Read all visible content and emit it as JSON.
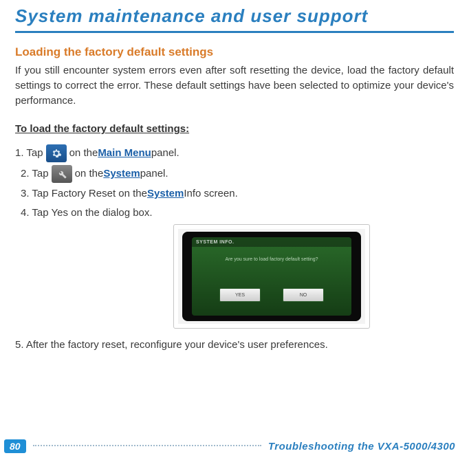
{
  "header": {
    "title": "System maintenance and user support"
  },
  "section": {
    "title": "Loading the factory default settings",
    "intro": "If you still encounter system errors even after soft resetting the device, load the factory default settings to correct the error. These default settings have been selected to optimize your device's performance.",
    "sub_head": "To load the factory default settings:"
  },
  "steps": {
    "s1_a": "1. Tap ",
    "s1_b": " on the ",
    "s1_link": "Main Menu",
    "s1_c": " panel.",
    "s2_a": "2. Tap ",
    "s2_b": " on the ",
    "s2_link": "System",
    "s2_c": " panel.",
    "s3_a": "3. Tap Factory Reset on the ",
    "s3_link": "System",
    "s3_b": " Info screen.",
    "s4": "4. Tap Yes on the dialog box.",
    "s5": "5. After the factory reset, reconfigure your device's user preferences."
  },
  "device": {
    "top_label": "SYSTEM INFO.",
    "prompt": "Are you sure to load factory default setting?",
    "yes": "YES",
    "no": "NO"
  },
  "footer": {
    "page": "80",
    "text": "Troubleshooting the VXA-5000/4300"
  }
}
